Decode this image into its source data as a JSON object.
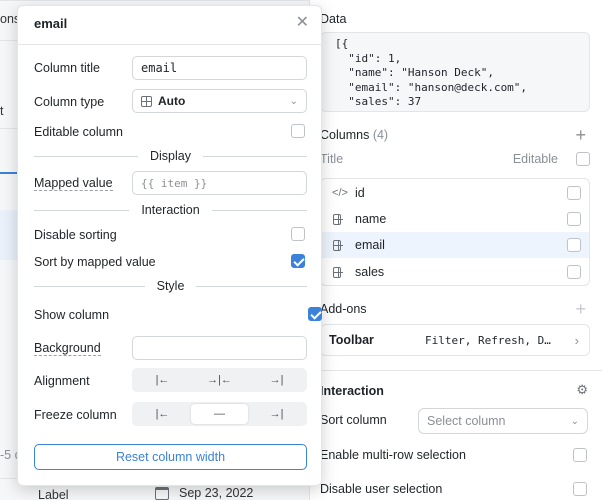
{
  "background": {
    "tab_fragment": "ons",
    "row_fragment": "t",
    "left_fragment": "-5 c",
    "bottom_label": "Label",
    "bottom_date": "Sep 23, 2022"
  },
  "right_panel": {
    "data_title": "Data",
    "json_text": "[{\n  \"id\": 1,\n  \"name\": \"Hanson Deck\",\n  \"email\": \"hanson@deck.com\",\n  \"sales\": 37",
    "columns_title": "Columns",
    "columns_count": "(4)",
    "col_header_title": "Title",
    "col_header_editable": "Editable",
    "columns": [
      {
        "label": "id",
        "icon": "code-icon"
      },
      {
        "label": "name",
        "icon": "grid-icon"
      },
      {
        "label": "email",
        "icon": "grid-icon"
      },
      {
        "label": "sales",
        "icon": "grid-icon"
      }
    ],
    "addons_title": "Add-ons",
    "toolbar_label": "Toolbar",
    "toolbar_value": "Filter, Refresh, D…",
    "interaction_title": "Interaction",
    "sort_column_label": "Sort column",
    "sort_column_placeholder": "Select column",
    "multi_row_label": "Enable multi-row selection",
    "disable_user_label": "Disable user selection"
  },
  "modal": {
    "title": "email",
    "close": "✕",
    "column_title_label": "Column title",
    "column_title_value": "email",
    "column_type_label": "Column type",
    "column_type_value": "Auto",
    "editable_label": "Editable column",
    "display_section": "Display",
    "mapped_value_label": "Mapped value",
    "mapped_value_placeholder": "{{ item }}",
    "interaction_section": "Interaction",
    "disable_sorting_label": "Disable sorting",
    "sort_mapped_label": "Sort by mapped value",
    "style_section": "Style",
    "show_column_label": "Show column",
    "background_label": "Background",
    "alignment_label": "Alignment",
    "alignment_options": [
      "|←",
      "→|←",
      "→|"
    ],
    "freeze_label": "Freeze column",
    "freeze_options": [
      "|←",
      "—",
      "→|"
    ],
    "reset_button": "Reset column width"
  },
  "colors": {
    "accent": "#3b82d8",
    "border": "#e3e5e8",
    "muted": "#8b8f96"
  }
}
